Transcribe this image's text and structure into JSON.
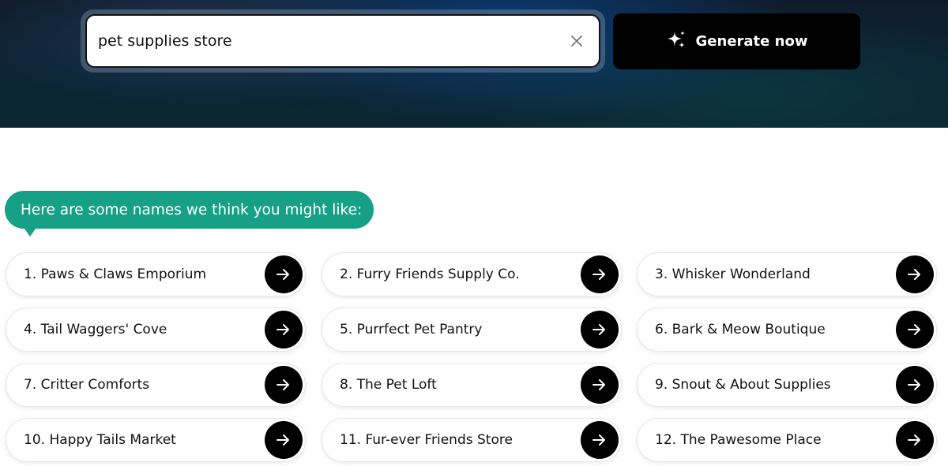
{
  "search": {
    "value": "pet supplies store",
    "clear_icon": "close-icon"
  },
  "generate_button": {
    "label": "Generate now",
    "icon": "sparkles-icon"
  },
  "results": {
    "intro": "Here are some names we think you might like:",
    "items": [
      {
        "label": "1. Paws & Claws Emporium"
      },
      {
        "label": "2. Furry Friends Supply Co."
      },
      {
        "label": "3. Whisker Wonderland"
      },
      {
        "label": "4. Tail Waggers' Cove"
      },
      {
        "label": "5. Purrfect Pet Pantry"
      },
      {
        "label": "6. Bark & Meow Boutique"
      },
      {
        "label": "7. Critter Comforts"
      },
      {
        "label": "8. The Pet Loft"
      },
      {
        "label": "9. Snout & About Supplies"
      },
      {
        "label": "10. Happy Tails Market"
      },
      {
        "label": "11. Fur-ever Friends Store"
      },
      {
        "label": "12. The Pawesome Place"
      }
    ]
  },
  "colors": {
    "accent_green": "#16a085",
    "button_black": "#000000"
  }
}
